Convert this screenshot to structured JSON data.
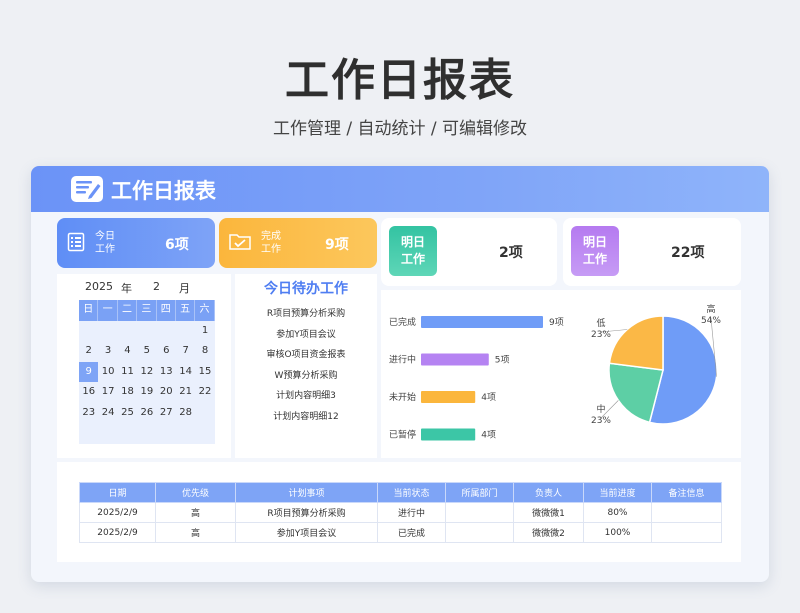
{
  "page": {
    "title": "工作日报表",
    "subtitle": "工作管理 /  自动统计  /  可编辑修改"
  },
  "sheet": {
    "header_title": "工作日报表"
  },
  "cards": {
    "today": {
      "label_line1": "今日",
      "label_line2": "工作",
      "value": "6项",
      "color": "#6a96f6"
    },
    "done": {
      "label_line1": "完成",
      "label_line2": "工作",
      "value": "9项",
      "color": "#fbb63c"
    },
    "tomorrow_a": {
      "label_line1": "明日",
      "label_line2": "工作",
      "value": "2项",
      "color": "#3cc6a6"
    },
    "tomorrow_b": {
      "label_line1": "明日",
      "label_line2": "工作",
      "value": "22项",
      "color": "#b77df0"
    }
  },
  "calendar": {
    "year": "2025",
    "year_unit": "年",
    "month": "2",
    "month_unit": "月",
    "weekdays": [
      "日",
      "一",
      "二",
      "三",
      "四",
      "五",
      "六"
    ],
    "weeks": [
      [
        "",
        "",
        "",
        "",
        "",
        "",
        "1"
      ],
      [
        "2",
        "3",
        "4",
        "5",
        "6",
        "7",
        "8"
      ],
      [
        "9",
        "10",
        "11",
        "12",
        "13",
        "14",
        "15"
      ],
      [
        "16",
        "17",
        "18",
        "19",
        "20",
        "21",
        "22"
      ],
      [
        "23",
        "24",
        "25",
        "26",
        "27",
        "28",
        ""
      ],
      [
        "",
        "",
        "",
        "",
        "",
        "",
        ""
      ]
    ],
    "selected_day": "9"
  },
  "todo": {
    "title": "今日待办工作",
    "items": [
      "R项目预算分析采购",
      "参加Y项目会议",
      "审核O项目资金报表",
      "W预算分析采购",
      "计划内容明细3",
      "计划内容明细12"
    ]
  },
  "chart_data": [
    {
      "type": "bar",
      "orientation": "horizontal",
      "categories": [
        "已完成",
        "进行中",
        "未开始",
        "已暂停"
      ],
      "values": [
        9,
        5,
        4,
        4
      ],
      "value_labels": [
        "9项",
        "5项",
        "4项",
        "4项"
      ],
      "colors": [
        "#6f9cf7",
        "#b583f2",
        "#fbb63c",
        "#3cc6a6"
      ]
    },
    {
      "type": "pie",
      "categories": [
        "高",
        "中",
        "低"
      ],
      "values": [
        54,
        23,
        23
      ],
      "value_labels": [
        "54%",
        "23%",
        "23%"
      ],
      "colors": [
        "#6f9cf7",
        "#5dcfa5",
        "#fbb846"
      ]
    }
  ],
  "table": {
    "headers": [
      "日期",
      "优先级",
      "计划事项",
      "当前状态",
      "所属部门",
      "负责人",
      "当前进度",
      "备注信息"
    ],
    "rows": [
      [
        "2025/2/9",
        "高",
        "R项目预算分析采购",
        "进行中",
        "",
        "微微微1",
        "80%",
        ""
      ],
      [
        "2025/2/9",
        "高",
        "参加Y项目会议",
        "已完成",
        "",
        "微微微2",
        "100%",
        ""
      ]
    ]
  }
}
